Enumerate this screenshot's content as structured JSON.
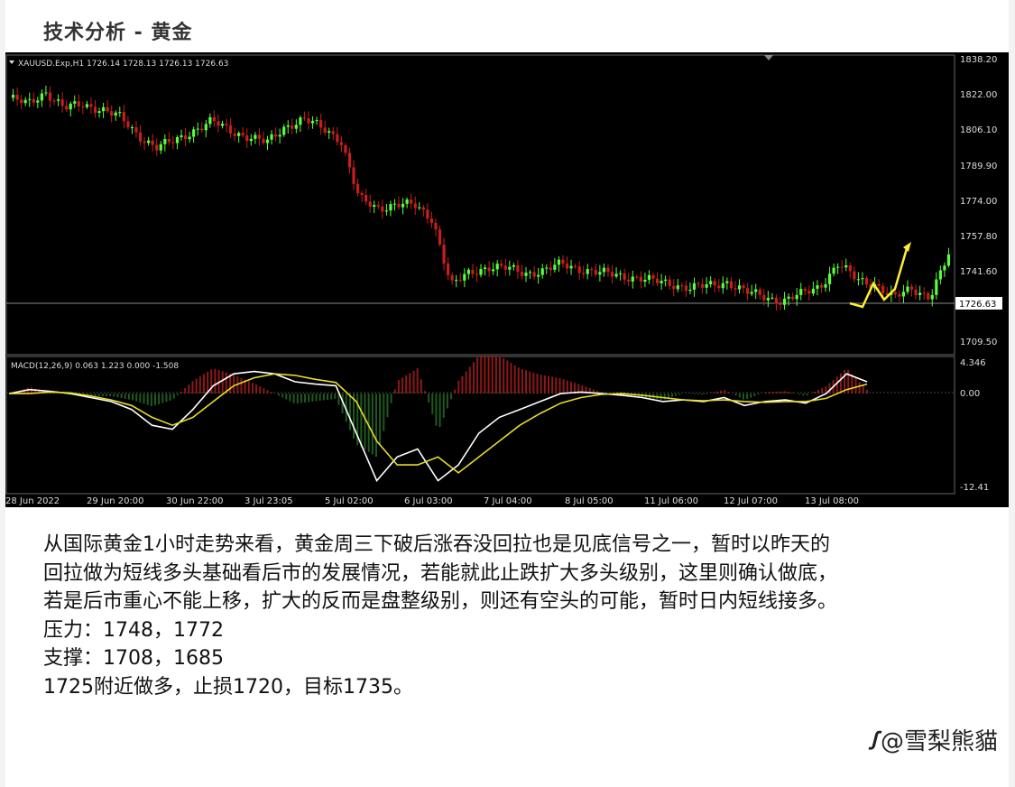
{
  "page": {
    "title": "技术分析 - 黄金"
  },
  "chart_header": "XAUUSD.Exp,H1  1726.14 1728.13 1726.13 1726.63",
  "macd_header": "MACD(12,26,9) 0.063 1.223 0.000 -1.508",
  "price_axis": [
    "1838.20",
    "1822.00",
    "1806.10",
    "1789.90",
    "1774.00",
    "1757.80",
    "1741.60",
    "1709.50"
  ],
  "current_price": "1726.63",
  "macd_axis": [
    "4.346",
    "0.00",
    "-12.41"
  ],
  "x_labels": [
    "28 Jun 2022",
    "29 Jun 20:00",
    "30 Jun 22:00",
    "3 Jul 23:05",
    "5 Jul 02:00",
    "6 Jul 03:00",
    "7 Jul 04:00",
    "8 Jul 05:00",
    "11 Jul 06:00",
    "12 Jul 07:00",
    "13 Jul 08:00"
  ],
  "chart_data": {
    "type": "line",
    "title": "",
    "series": [
      {
        "name": "XAUUSD.Exp,H1",
        "values": [
          1821,
          1818,
          1824,
          1816,
          1818,
          1816,
          1812,
          1804,
          1798,
          1801,
          1806,
          1810,
          1806,
          1803,
          1800,
          1808,
          1811,
          1807,
          1802,
          1774,
          1770,
          1772,
          1771,
          1765,
          1734,
          1740,
          1743,
          1742,
          1740,
          1741,
          1744,
          1742,
          1740,
          1739,
          1738,
          1736,
          1735,
          1733,
          1734,
          1736,
          1731,
          1729,
          1727,
          1730,
          1734,
          1744,
          1737,
          1735,
          1728,
          1733,
          1729,
          1748
        ]
      },
      {
        "name": "MACD(12,26,9)",
        "values": [
          0,
          0.5,
          0.3,
          0,
          -0.5,
          -1,
          -2,
          -4,
          -4.5,
          -2,
          1,
          2.5,
          2.8,
          2.5,
          1.5,
          1.2,
          1,
          -5,
          -11,
          -8,
          -7,
          -11,
          -9,
          -5,
          -3,
          -2,
          -1,
          0,
          0.2,
          0,
          -0.2,
          -0.5,
          -1,
          -0.8,
          -1,
          -0.5,
          -1.5,
          -1,
          -0.8,
          -1.2,
          0,
          2.5,
          1.5
        ]
      },
      {
        "name": "Signal",
        "values": [
          0,
          0,
          0.2,
          0.1,
          -0.3,
          -0.8,
          -1.5,
          -3,
          -4,
          -3,
          -1,
          1,
          2,
          2.5,
          2.3,
          1.8,
          1.4,
          -1,
          -6,
          -9,
          -9,
          -8,
          -10,
          -8,
          -6,
          -4,
          -2.5,
          -1.2,
          -0.5,
          -0.1,
          0,
          -0.2,
          -0.5,
          -0.8,
          -0.9,
          -0.8,
          -1,
          -1.1,
          -1,
          -1,
          -0.6,
          0.5,
          1.2
        ]
      }
    ],
    "ylim": [
      1703,
      1840
    ],
    "macd_ylim": [
      -12.41,
      4.346
    ],
    "annotations": [
      {
        "type": "arrow",
        "color": "#ffee33"
      }
    ]
  },
  "body_text": [
    "从国际黄金1小时走势来看，黄金周三下破后涨吞没回拉也是见底信号之一，暂时以昨天的",
    "回拉做为短线多头基础看后市的发展情况，若能就此止跌扩大多头级别，这里则确认做底，",
    "若是后市重心不能上移，扩大的反而是盘整级别，则还有空头的可能，暂时日内短线接多。",
    "压力：1748，1772",
    "支撑：1708，1685",
    "1725附近做多，止损1720，目标1735。"
  ],
  "watermark": {
    "icon": "ꭍ",
    "text": "@雪梨熊貓"
  },
  "colors": {
    "up": "#5aff3b",
    "down": "#c81e1e",
    "macd_line": "#ffffff",
    "signal_line": "#e6dc28",
    "hist_up": "#8b1a1a",
    "hist_down": "#1f5a1f"
  }
}
